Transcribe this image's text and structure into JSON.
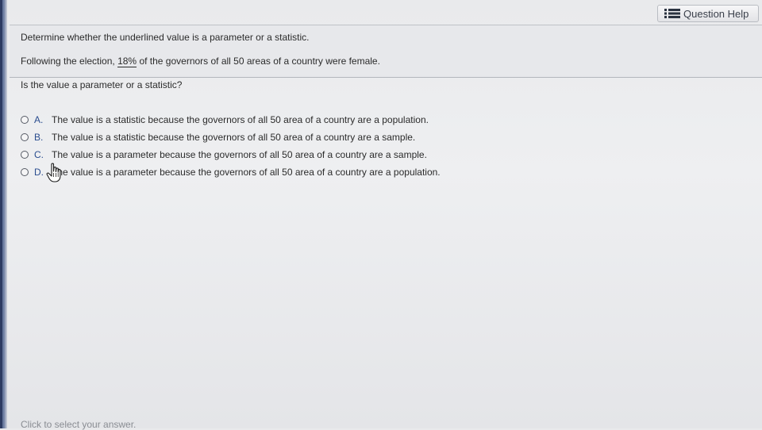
{
  "header": {
    "help_label": "Question Help",
    "help_icon": "list-icon"
  },
  "instruction": "Determine whether the underlined value is a parameter or a statistic.",
  "prompt": {
    "before": "Following the election, ",
    "underlined": "18%",
    "after": " of the governors of all 50 areas of a country were female."
  },
  "question": "Is the value a parameter or a statistic?",
  "choices": [
    {
      "letter": "A.",
      "text": "The value is a statistic because the governors of all 50 area of a country are a population."
    },
    {
      "letter": "B.",
      "text": "The value is a statistic because the governors of all 50 area of a country are a sample."
    },
    {
      "letter": "C.",
      "text": "The value is a parameter because the governors of all 50 area of a country are a sample."
    },
    {
      "letter": "D.",
      "text": "The value is a parameter because the governors of all 50 area of a country are a population."
    }
  ],
  "footer": {
    "hint": "Click to select your answer."
  },
  "colors": {
    "accent": "#2a4d8f",
    "background": "#e9eaec"
  }
}
